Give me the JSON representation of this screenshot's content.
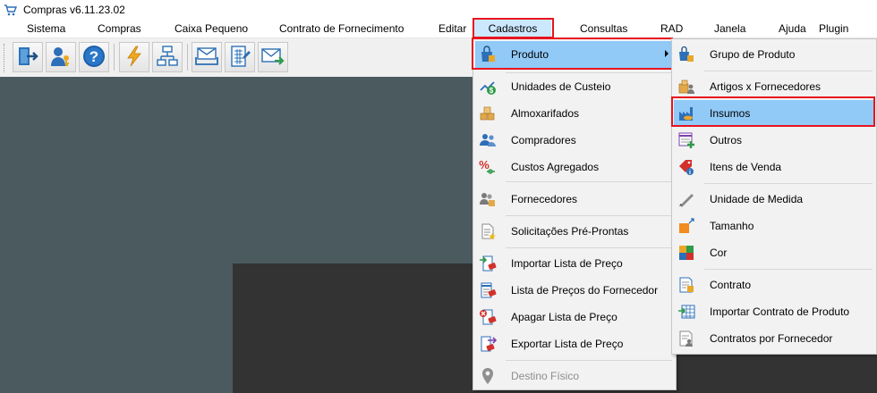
{
  "window": {
    "title": "Compras v6.11.23.02",
    "app_icon": "shopping-cart-icon"
  },
  "menubar": {
    "items": [
      {
        "label": "Sistema"
      },
      {
        "label": "Compras"
      },
      {
        "label": "Caixa Pequeno"
      },
      {
        "label": "Contrato de Fornecimento"
      },
      {
        "label": "Editar"
      },
      {
        "label": "Cadastros"
      },
      {
        "label": "Consultas"
      },
      {
        "label": "RAD"
      },
      {
        "label": "Janela"
      },
      {
        "label": "Ajuda"
      },
      {
        "label": "Plugin"
      }
    ],
    "active": "Cadastros"
  },
  "toolbar": {
    "icons": [
      "exit-door-icon",
      "user-key-icon",
      "help-icon",
      "lightning-icon",
      "network-icon",
      "mail-tray-icon",
      "calculator-icon",
      "send-mail-icon"
    ]
  },
  "cadastros_menu": {
    "items": [
      {
        "label": "Produto",
        "icon": "product-bag-icon",
        "highlighted": true,
        "has_submenu": true
      },
      {
        "label": "Unidades de Custeio",
        "icon": "cost-chart-icon"
      },
      {
        "label": "Almoxarifados",
        "icon": "boxes-icon"
      },
      {
        "label": "Compradores",
        "icon": "people-icon"
      },
      {
        "label": "Custos Agregados",
        "icon": "percent-icon"
      },
      {
        "label": "Fornecedores",
        "icon": "supplier-icon"
      },
      {
        "label": "Solicitações Pré-Prontas",
        "icon": "document-star-icon"
      },
      {
        "label": "Importar Lista de Preço",
        "icon": "import-price-list-icon"
      },
      {
        "label": "Lista de Preços do Fornecedor",
        "icon": "price-list-icon"
      },
      {
        "label": "Apagar Lista de Preço",
        "icon": "delete-price-list-icon"
      },
      {
        "label": "Exportar Lista de Preço",
        "icon": "export-price-list-icon"
      },
      {
        "label": "Destino Físico",
        "icon": "location-pin-icon",
        "disabled": true
      }
    ]
  },
  "produto_submenu": {
    "items": [
      {
        "label": "Grupo de Produto",
        "icon": "product-group-icon"
      },
      {
        "label": "Artigos x Fornecedores",
        "icon": "articles-suppliers-icon"
      },
      {
        "label": "Insumos",
        "icon": "factory-icon",
        "highlighted": true
      },
      {
        "label": "Outros",
        "icon": "other-list-icon"
      },
      {
        "label": "Itens de Venda",
        "icon": "sale-tag-icon"
      },
      {
        "label": "Unidade de Medida",
        "icon": "ruler-pencil-icon"
      },
      {
        "label": "Tamanho",
        "icon": "size-square-icon"
      },
      {
        "label": "Cor",
        "icon": "color-grid-icon"
      },
      {
        "label": "Contrato",
        "icon": "contract-icon"
      },
      {
        "label": "Importar Contrato de Produto",
        "icon": "import-contract-icon"
      },
      {
        "label": "Contratos por Fornecedor",
        "icon": "supplier-contracts-icon"
      }
    ]
  },
  "colors": {
    "menu_highlight": "#91c9f7",
    "menubar_active": "#cce8ff",
    "annotation_box": "#e8141e",
    "workspace": "#4a5a5f",
    "dark_panel": "#333333"
  }
}
